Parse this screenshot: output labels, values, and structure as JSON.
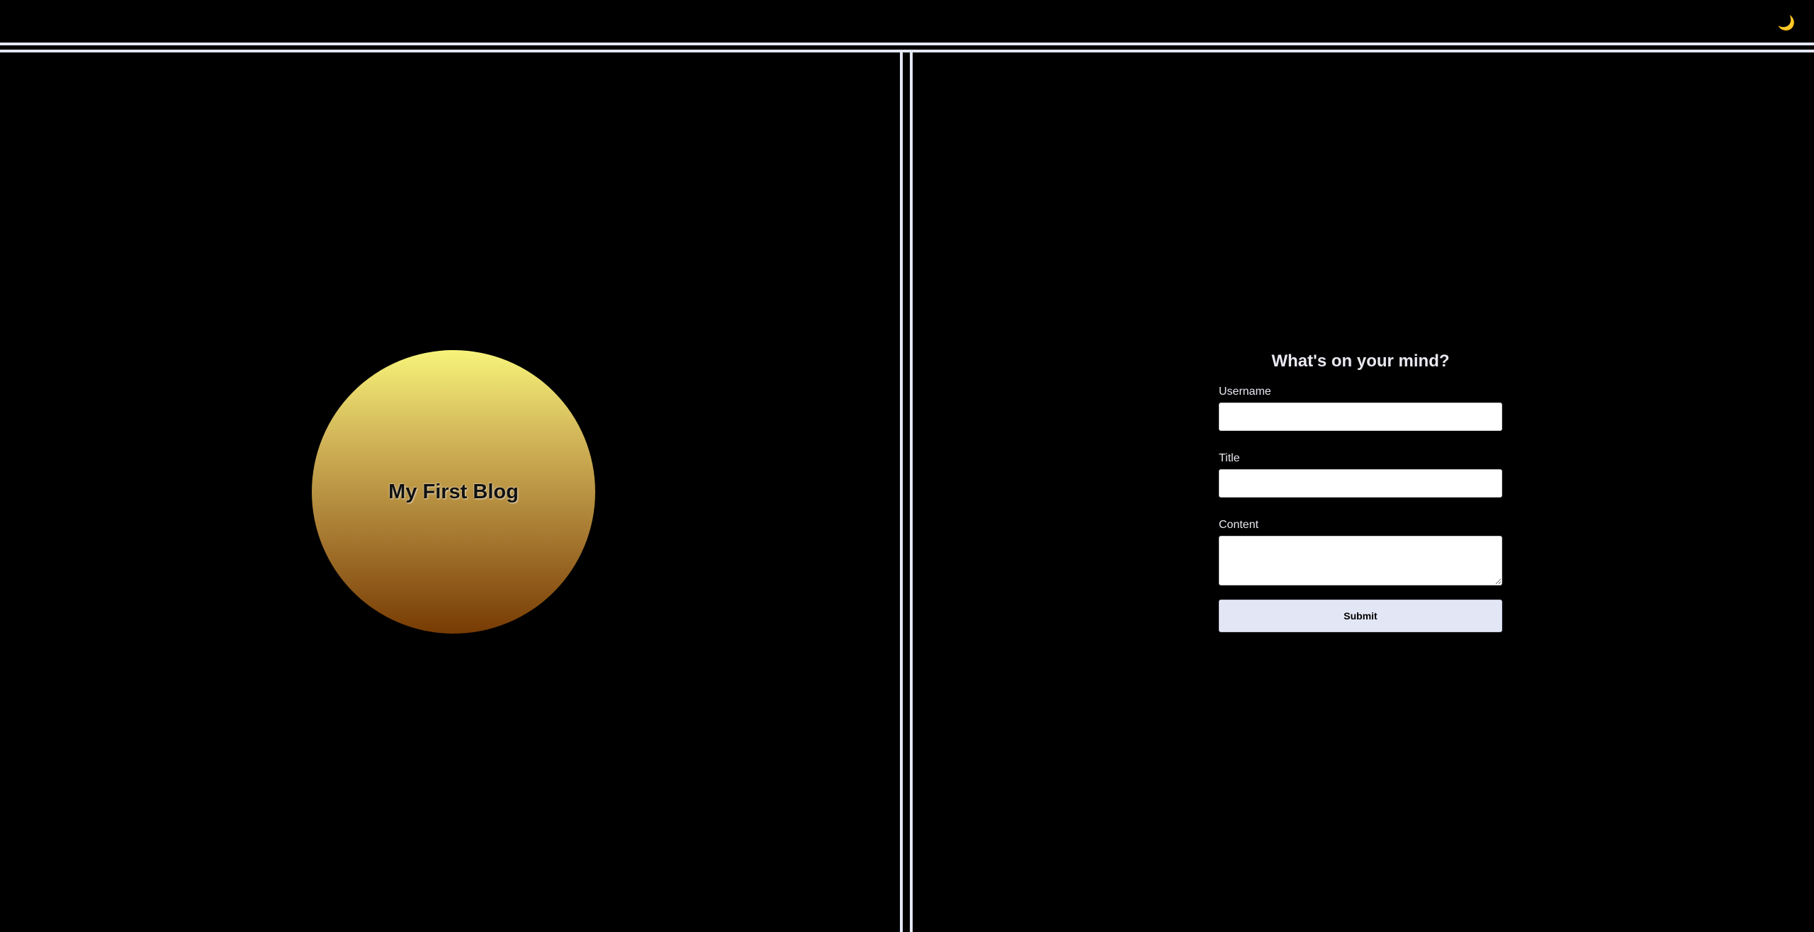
{
  "header": {
    "theme_toggle_icon": "moon-icon",
    "theme_toggle_glyph": "🌙"
  },
  "hero": {
    "title": "My First Blog"
  },
  "form": {
    "heading": "What's on your mind?",
    "username_label": "Username",
    "username_value": "",
    "title_label": "Title",
    "title_value": "",
    "content_label": "Content",
    "content_value": "",
    "submit_label": "Submit"
  },
  "colors": {
    "background": "#000000",
    "divider": "#e3e6f5",
    "button_bg": "#e3e6f5",
    "gradient_top": "#f7f47a",
    "gradient_bottom": "#773b03"
  }
}
